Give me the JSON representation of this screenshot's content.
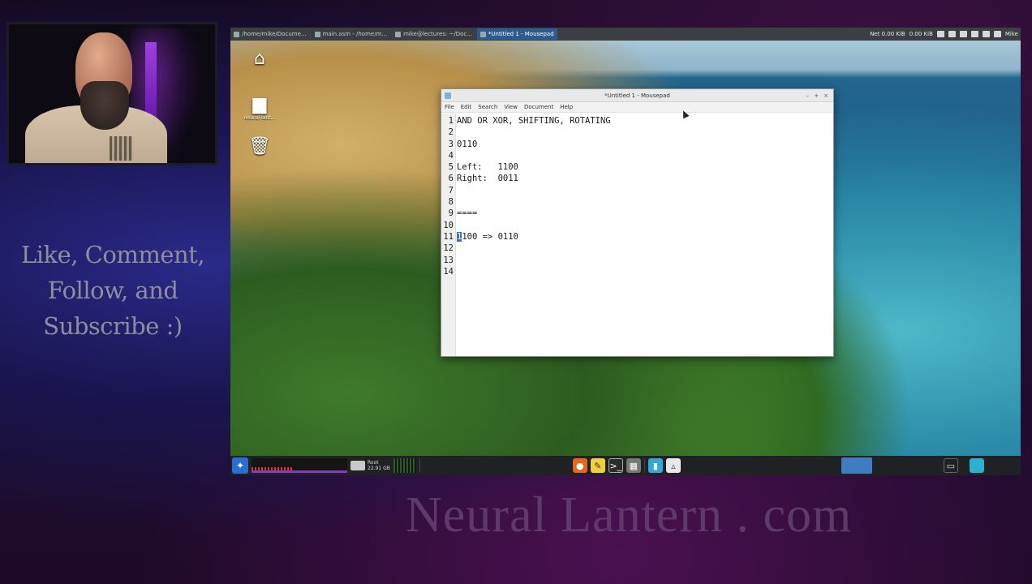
{
  "overlay": {
    "promo_lines": [
      "Like, Comment,",
      "Follow, and",
      "Subscribe :)"
    ],
    "watermark": "Neural Lantern . com"
  },
  "topbar": {
    "tasks": [
      {
        "label": "/home/mike/Docume...",
        "active": false
      },
      {
        "label": "main.asm - /home/m...",
        "active": false
      },
      {
        "label": "mike@lectures: ~/Doc...",
        "active": false
      },
      {
        "label": "*Untitled 1 - Mousepad",
        "active": true
      }
    ],
    "net_label": "Net 0.00 KiB",
    "disk_label": "0.00 KiB",
    "user": "Mike"
  },
  "desktop": {
    "icons": [
      {
        "name": "home-icon",
        "glyph": "⌂",
        "label": ""
      },
      {
        "name": "folder-icon",
        "glyph": "▆",
        "label": "neural-lant..."
      },
      {
        "name": "trash-icon",
        "glyph": "🗑",
        "label": ""
      }
    ]
  },
  "mousepad": {
    "title": "*Untitled 1 - Mousepad",
    "menu": [
      "File",
      "Edit",
      "Search",
      "View",
      "Document",
      "Help"
    ],
    "lines": [
      "AND OR XOR, SHIFTING, ROTATING",
      "",
      "0110",
      "",
      "Left:   1100",
      "Right:  0011",
      "",
      "",
      "====",
      "",
      "1100 => 0110",
      "",
      "",
      ""
    ],
    "line_numbers": [
      "1",
      "2",
      "3",
      "4",
      "5",
      "6",
      "7",
      "8",
      "9",
      "10",
      "11",
      "12",
      "13",
      "14"
    ],
    "caret_line": 11
  },
  "panel": {
    "drive_name": "Root",
    "drive_free": "22.91 GB"
  }
}
